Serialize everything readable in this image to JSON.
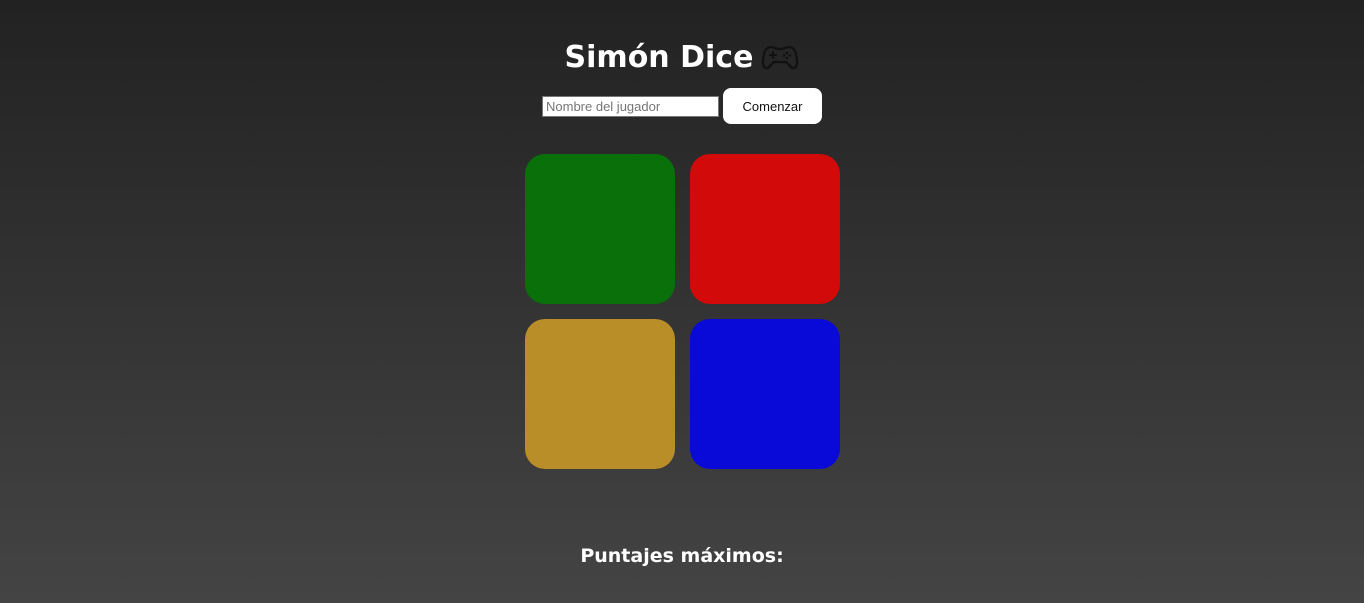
{
  "header": {
    "title": "Simón Dice",
    "title_icon": "gamepad-icon"
  },
  "controls": {
    "name_placeholder": "Nombre del jugador",
    "name_value": "",
    "start_label": "Comenzar"
  },
  "board": {
    "pads": [
      {
        "name": "green",
        "color": "#0a700a"
      },
      {
        "name": "red",
        "color": "#d30a0a"
      },
      {
        "name": "yellow",
        "color": "#b98d27"
      },
      {
        "name": "blue",
        "color": "#0a0ad8"
      }
    ]
  },
  "scores": {
    "title": "Puntajes máximos:",
    "entries": []
  }
}
